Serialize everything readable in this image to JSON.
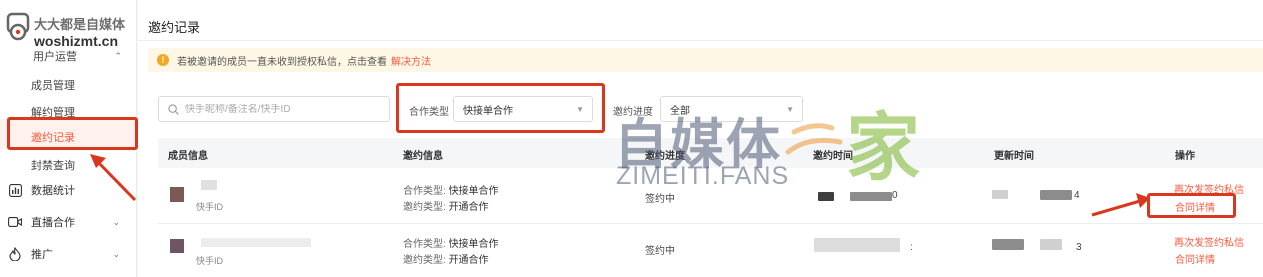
{
  "watermark": {
    "site_cn": "大大都是自媒体",
    "site_url": "woshizmt.cn",
    "big_cn": "自媒体",
    "big_jia": "家",
    "big_en": "ZIMEITI.FANS"
  },
  "sidebar": {
    "group_label": "用户运营",
    "sub_items": [
      "成员管理",
      "解约管理",
      "邀约记录",
      "封禁查询"
    ],
    "active_item": "邀约记录",
    "nav_items": [
      {
        "label": "数据统计",
        "icon": "bar-chart-icon"
      },
      {
        "label": "直播合作",
        "icon": "live-camera-icon"
      },
      {
        "label": "推广",
        "icon": "promotion-icon"
      }
    ]
  },
  "page": {
    "title": "邀约记录",
    "notice_text": "若被邀请的成员一直未收到授权私信，点击查看",
    "notice_link": "解决方法"
  },
  "filters": {
    "search_placeholder": "快手昵称/备注名/快手ID",
    "coop_type_label": "合作类型",
    "coop_type_value": "快接单合作",
    "progress_label": "邀约进度",
    "progress_value": "全部"
  },
  "table": {
    "headers": [
      "成员信息",
      "邀约信息",
      "邀约进度",
      "邀约时间",
      "更新时间",
      "操作"
    ],
    "rows": [
      {
        "member_id_label": "快手ID",
        "coop_type_key": "合作类型:",
        "coop_type_val": "快接单合作",
        "invite_type_key": "邀约类型:",
        "invite_type_val": "开通合作",
        "progress": "签约中",
        "invite_time_tail": "0",
        "update_time_tail": "4",
        "action_1": "再次发签约私信",
        "action_2": "合同详情"
      },
      {
        "member_id_label": "快手ID",
        "coop_type_key": "合作类型:",
        "coop_type_val": "快接单合作",
        "invite_type_key": "邀约类型:",
        "invite_type_val": "开通合作",
        "progress": "签约中",
        "invite_time_tail": ":",
        "update_time_tail": "3",
        "action_1": "再次发签约私信",
        "action_2": "合同详情"
      }
    ]
  },
  "colors": {
    "accent": "#fe5a3c",
    "annotation": "#d9381e",
    "notice_bg": "#fff7e6",
    "watermark_green": "#79b52a"
  }
}
